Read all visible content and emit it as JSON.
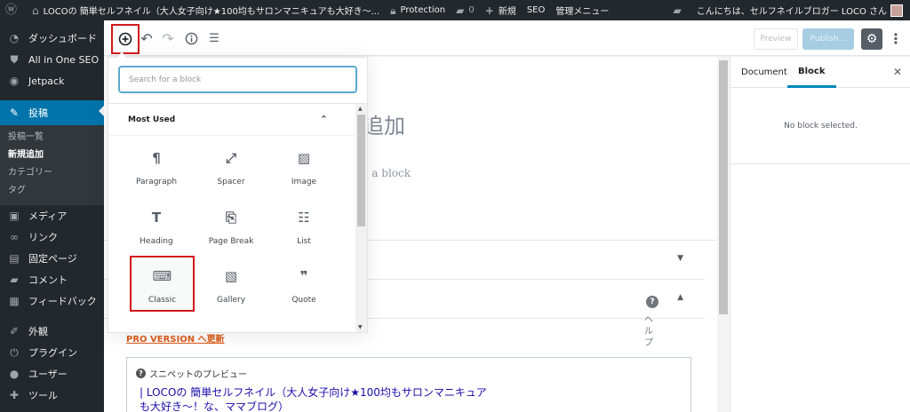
{
  "admin_bar": {
    "wp_logo_icon": "wordpress-icon",
    "site_name": "LOCOの 簡単セルフネイル（大人女子向け★100均もサロンマニキュアも大好き～...",
    "protection_label": "Protection",
    "comment_count": "0",
    "new_label": "新規",
    "seo_label": "SEO",
    "admin_menu_label": "管理メニュー",
    "greeting": "こんにちは、セルフネイルブロガー LOCO さん"
  },
  "sidebar": {
    "items_top": [
      {
        "label": "ダッシュボード",
        "icon": "dashboard-icon"
      },
      {
        "label": "All in One SEO",
        "icon": "shield-icon"
      },
      {
        "label": "Jetpack",
        "icon": "jetpack-icon"
      }
    ],
    "active": {
      "label": "投稿",
      "icon": "pin-icon"
    },
    "submenu": [
      "投稿一覧",
      "新規追加",
      "カテゴリー",
      "タグ"
    ],
    "items_bottom": [
      {
        "label": "メディア",
        "icon": "media-icon"
      },
      {
        "label": "リンク",
        "icon": "link-icon"
      },
      {
        "label": "固定ページ",
        "icon": "page-icon"
      },
      {
        "label": "コメント",
        "icon": "comment-icon"
      },
      {
        "label": "フィードバック",
        "icon": "feedback-icon"
      },
      {
        "label": "外観",
        "icon": "brush-icon"
      },
      {
        "label": "プラグイン",
        "icon": "plugin-icon"
      },
      {
        "label": "ユーザー",
        "icon": "user-icon"
      },
      {
        "label": "ツール",
        "icon": "wrench-icon"
      }
    ]
  },
  "toolbar": {
    "preview_label": "Preview",
    "publish_label": "Publish..."
  },
  "editor": {
    "title_placeholder": "追加",
    "block_placeholder": "ose a block",
    "help_text": "ヘルプ",
    "pro_link": "PRO VERSION へ更新",
    "snippet_header": "スニペットのプレビュー",
    "snippet_title": "| LOCOの 簡単セルフネイル（大人女子向け★100均もサロンマニキュアも大好き～！な、ママブログ）"
  },
  "settings_panel": {
    "tab_document": "Document",
    "tab_block": "Block",
    "empty_text": "No block selected."
  },
  "inserter": {
    "search_placeholder": "Search for a block",
    "panel_title": "Most Used",
    "blocks": [
      {
        "label": "Paragraph",
        "icon": "paragraph-icon"
      },
      {
        "label": "Spacer",
        "icon": "spacer-icon"
      },
      {
        "label": "Image",
        "icon": "image-icon"
      },
      {
        "label": "Heading",
        "icon": "heading-icon"
      },
      {
        "label": "Page Break",
        "icon": "page-break-icon"
      },
      {
        "label": "List",
        "icon": "list-icon"
      },
      {
        "label": "Classic",
        "icon": "keyboard-icon"
      },
      {
        "label": "Gallery",
        "icon": "gallery-icon"
      },
      {
        "label": "Quote",
        "icon": "quote-icon"
      }
    ]
  },
  "colors": {
    "admin_dark": "#23282d",
    "accent_blue": "#0073aa",
    "highlight_red": "#d11a1a"
  }
}
